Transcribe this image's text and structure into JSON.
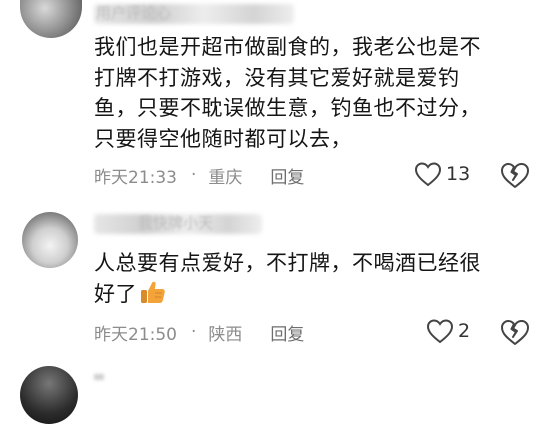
{
  "comments": [
    {
      "nickname": "用户评论心",
      "text_lines": [
        "我们也是开超市做副食的，我老公也是不",
        "打牌不打游戏，没有其它爱好就是爱钓",
        "鱼，只要不耽误做生意，钓鱼也不过分，",
        "只要得空他随时都可以去，"
      ],
      "time": "昨天21:33",
      "location": "重庆",
      "reply_label": "回复",
      "like_count": "13"
    },
    {
      "nickname": "我快牌小天",
      "text_lines": [
        "人总要有点爱好，不打牌，不喝酒已经很",
        "好了"
      ],
      "time": "昨天21:50",
      "location": "陕西",
      "reply_label": "回复",
      "like_count": "2"
    }
  ],
  "separator": "·",
  "icons": [
    "heart-outline-icon",
    "broken-heart-icon",
    "thumbs-up-emoji"
  ],
  "colors": {
    "meta_text": "#8c8c8c",
    "thumb": "#f4a23a"
  }
}
